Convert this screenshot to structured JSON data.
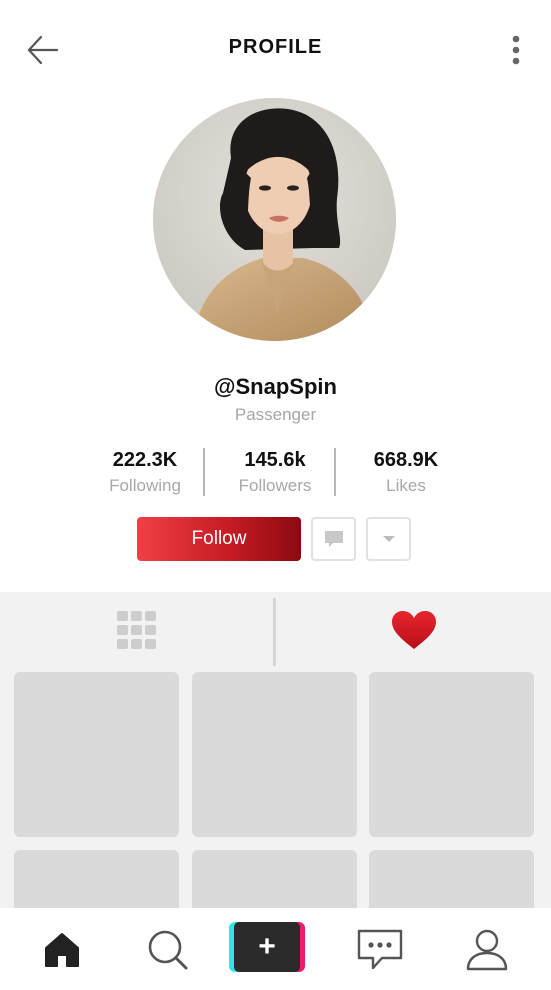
{
  "header": {
    "title": "PROFILE",
    "back_icon": "arrow-left-icon",
    "more_icon": "more-vertical-icon"
  },
  "profile": {
    "username": "@SnapSpin",
    "role": "Passenger",
    "avatar": "avatar-photo"
  },
  "stats": [
    {
      "value": "222.3K",
      "label": "Following"
    },
    {
      "value": "145.6k",
      "label": "Followers"
    },
    {
      "value": "668.9K",
      "label": "Likes"
    }
  ],
  "actions": {
    "follow_label": "Follow",
    "message_icon": "message-icon",
    "dropdown_icon": "caret-down-icon"
  },
  "tabs": [
    {
      "icon": "grid-icon"
    },
    {
      "icon": "heart-icon"
    }
  ],
  "colors": {
    "follow_gradient": [
      "#ef4044",
      "#8c0a12"
    ],
    "heart": "#d0161f",
    "tile": "#dadada",
    "content_bg": "#f2f2f2",
    "create_cyan": "#2ee6e6",
    "create_pink": "#f21b6b"
  },
  "bottom_nav": [
    {
      "icon": "home-icon"
    },
    {
      "icon": "search-icon"
    },
    {
      "icon": "plus-icon",
      "label": "+"
    },
    {
      "icon": "chat-icon"
    },
    {
      "icon": "user-icon"
    }
  ]
}
